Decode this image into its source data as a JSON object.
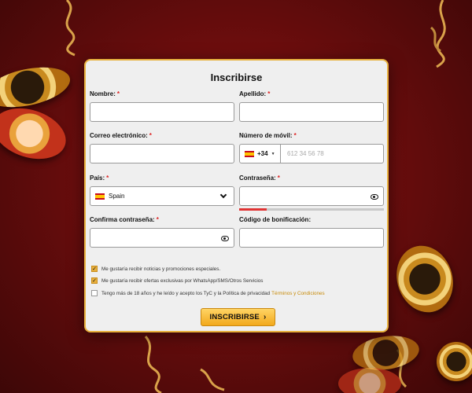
{
  "form": {
    "title": "Inscribirse",
    "first_name": {
      "label": "Nombre:",
      "required": "*",
      "value": ""
    },
    "last_name": {
      "label": "Apellido:",
      "required": "*",
      "value": ""
    },
    "email": {
      "label": "Correo electrónico:",
      "required": "*",
      "value": ""
    },
    "phone": {
      "label": "Número de móvil:",
      "required": "*",
      "prefix": "+34",
      "placeholder": "612 34 56 78",
      "flag_icon": "spain-flag-icon"
    },
    "country": {
      "label": "País:",
      "required": "*",
      "value": "Spain",
      "flag_icon": "spain-flag-icon"
    },
    "password": {
      "label": "Contraseña:",
      "required": "*",
      "value": "",
      "strength_level": 0.19,
      "strength_color": "#e03333"
    },
    "confirm_password": {
      "label": "Confirma contraseña:",
      "required": "*",
      "value": ""
    },
    "bonus_code": {
      "label": "Código de bonificación:",
      "value": ""
    },
    "checkboxes": [
      {
        "text": "Me gustaría recibir noticias y promociones especiales.",
        "checked": true
      },
      {
        "text": "Me gustaría recibir ofertas exclusivas por WhatsApp/SMS/Otros Servicios",
        "checked": true
      },
      {
        "text": "Tengo más de 18 años y he leído y acepto los TyC y la Política de privacidad",
        "link_text": "Términos y Condiciones",
        "checked": false
      }
    ],
    "submit_label": "INSCRIBIRSE",
    "submit_icon": "chevron-right-icon"
  },
  "theme": {
    "accent": "#e8b13e",
    "button": "#f2a91c",
    "background": "#6a0d0d",
    "link": "#c78a07"
  }
}
